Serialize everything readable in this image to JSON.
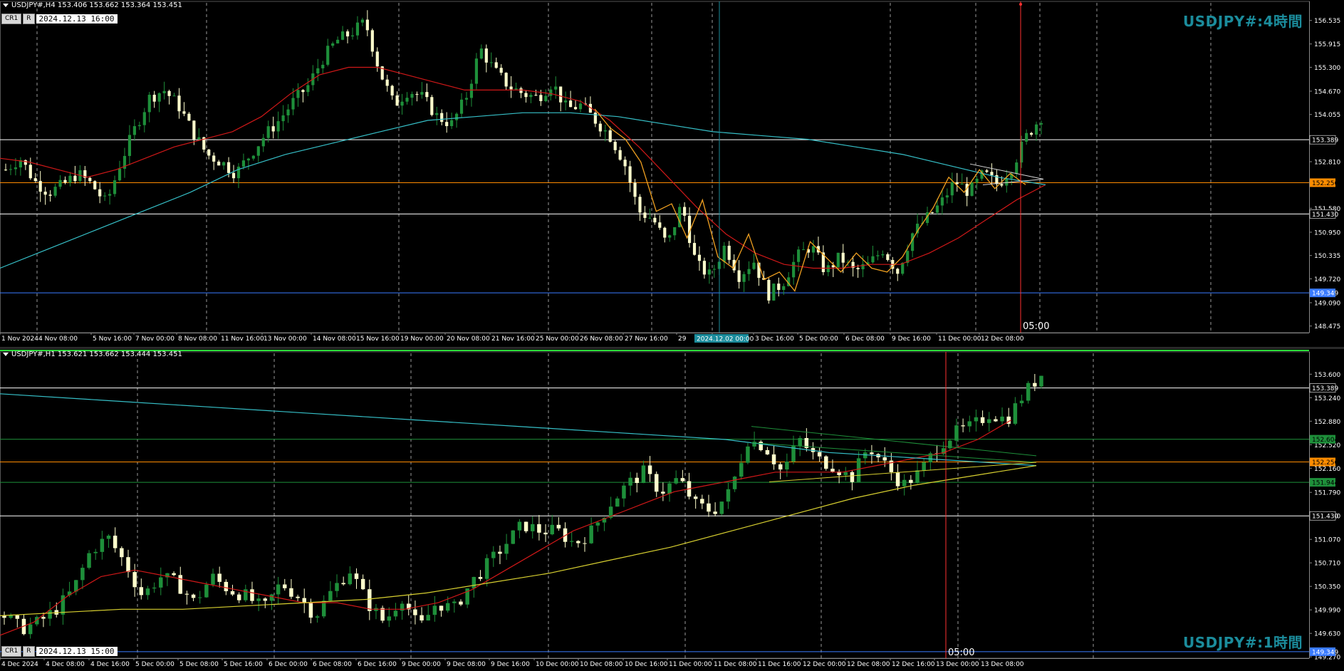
{
  "top": {
    "info": "USDJPY#,H4  153.406 153.662 153.364 153.451",
    "btn_cr": "CR1",
    "btn_r": "R",
    "date": "2024.12.13 16:00",
    "big_title": "USDJPY#:4時間",
    "countdown": "05:00",
    "crosshair_label": "2024.12.02 00:00"
  },
  "bottom": {
    "info": "USDJPY#,H1  153.621 153.662 153.444 153.451",
    "btn_cr": "CR1",
    "btn_r": "R",
    "date": "2024.12.13 15:00",
    "big_title": "USDJPY#:1時間",
    "countdown": "05:00"
  },
  "colors": {
    "bull": "#1e8f3a",
    "bear": "#ffffcc",
    "ma_red": "#d01818",
    "ma_cyan": "#36c0c8",
    "ma_yellow": "#d8d030",
    "zigzag": "#f0a020",
    "level_white": "#ffffff",
    "level_orange": "#ff8c00",
    "level_blue": "#3a7bff",
    "level_green": "#1e8f3a",
    "vline_cyan": "#1b8c9c",
    "vline_red": "#ff3030",
    "grid": "#9a9a9a"
  },
  "chart_data": [
    {
      "type": "candlestick",
      "timeframe": "H4",
      "symbol": "USDJPY#",
      "ylim": [
        148.3,
        157.0
      ],
      "yticks": [
        "156.535",
        "155.915",
        "155.300",
        "154.670",
        "154.055",
        "152.810",
        "151.580",
        "150.950",
        "150.335",
        "149.720",
        "149.090",
        "148.475"
      ],
      "levels": [
        {
          "name": "resistance-1",
          "value": 153.389,
          "color": "#ffffff",
          "label": "153.389",
          "label_bg": "#000000",
          "label_fg": "#ffffff"
        },
        {
          "name": "pivot",
          "value": 152.256,
          "color": "#ff8c00",
          "label": "152.256",
          "label_bg": "#ff8c00",
          "label_fg": "#000000"
        },
        {
          "name": "support-1",
          "value": 151.43,
          "color": "#ffffff",
          "label": "151.430",
          "label_bg": "#000000",
          "label_fg": "#ffffff"
        },
        {
          "name": "support-2",
          "value": 149.349,
          "color": "#3a7bff",
          "label": "149.349",
          "label_bg": "#3a7bff",
          "label_fg": "#ffffff"
        }
      ],
      "xticks": [
        "1 Nov 2024",
        "4 Nov 08:00",
        "5 Nov 16:00",
        "7 Nov 00:00",
        "8 Nov 08:00",
        "11 Nov 16:00",
        "13 Nov 00:00",
        "14 Nov 08:00",
        "15 Nov 16:00",
        "19 Nov 00:00",
        "20 Nov 08:00",
        "21 Nov 16:00",
        "25 Nov 00:00",
        "26 Nov 08:00",
        "27 Nov 16:00",
        "29 ",
        "08:00",
        "3 Dec 16:00",
        "5 Dec 00:00",
        "6 Dec 08:00",
        "9 Dec 16:00",
        "11 Dec 00:00",
        "12 Dec 08:00"
      ],
      "anchors": [
        152.6,
        152.9,
        152.3,
        152.0,
        152.2,
        152.5,
        152.2,
        151.7,
        152.8,
        153.7,
        154.5,
        154.7,
        154.3,
        153.6,
        153.0,
        152.8,
        152.5,
        153.0,
        153.5,
        153.9,
        154.4,
        154.8,
        155.5,
        156.0,
        156.2,
        156.5,
        155.2,
        154.3,
        154.7,
        154.5,
        154.0,
        153.8,
        154.5,
        155.8,
        155.2,
        154.8,
        154.6,
        154.5,
        154.9,
        154.2,
        154.3,
        153.9,
        153.5,
        152.8,
        151.5,
        151.3,
        150.6,
        151.7,
        150.1,
        149.8,
        150.6,
        149.8,
        150.2,
        149.3,
        149.6,
        150.3,
        150.6,
        149.9,
        150.3,
        149.9,
        150.1,
        150.5,
        149.9,
        150.9,
        151.3,
        151.7,
        152.3,
        152.0,
        152.5,
        152.2,
        152.7,
        153.5,
        154.0
      ],
      "ma_red": [
        152.9,
        152.8,
        152.6,
        152.4,
        152.6,
        152.9,
        153.2,
        153.4,
        153.6,
        154.0,
        154.6,
        155.1,
        155.3,
        155.3,
        155.1,
        154.9,
        154.7,
        154.7,
        154.7,
        154.6,
        154.4,
        153.9,
        153.2,
        152.4,
        151.6,
        150.9,
        150.4,
        150.1,
        150.0,
        150.0,
        150.1,
        150.1,
        150.4,
        150.8,
        151.3,
        151.8,
        152.2
      ],
      "ma_cyan": [
        150.0,
        150.5,
        151.0,
        151.5,
        152.0,
        152.6,
        153.0,
        153.3,
        153.6,
        153.9,
        154.0,
        154.1,
        154.1,
        154.0,
        153.8,
        153.6,
        153.5,
        153.4,
        153.2,
        153.0,
        152.7,
        152.4,
        152.2
      ],
      "zigzag": [
        154.2,
        153.7,
        153.4,
        152.8,
        151.5,
        151.7,
        150.8,
        151.8,
        150.3,
        150.0,
        150.9,
        149.7,
        149.9,
        149.4,
        150.7,
        150.3,
        149.9,
        150.4,
        150.0,
        149.9,
        150.3,
        151.0,
        151.6,
        152.4,
        152.0,
        152.6,
        152.1,
        152.5,
        152.2
      ]
    },
    {
      "type": "candlestick",
      "timeframe": "H1",
      "symbol": "USDJPY#",
      "ylim": [
        149.25,
        153.92
      ],
      "yticks": [
        "153.600",
        "153.240",
        "152.880",
        "152.520",
        "152.160",
        "151.790",
        "151.430",
        "151.070",
        "150.710",
        "150.350",
        "149.990",
        "149.630",
        "149.270"
      ],
      "levels": [
        {
          "name": "resistance-1",
          "value": 153.389,
          "color": "#ffffff",
          "label": "153.389",
          "label_bg": "#000000",
          "label_fg": "#ffffff"
        },
        {
          "name": "green-upper",
          "value": 152.604,
          "color": "#1e8f3a",
          "label": "152.604",
          "label_bg": "#1e8f3a",
          "label_fg": "#000000"
        },
        {
          "name": "pivot",
          "value": 152.256,
          "color": "#ff8c00",
          "label": "152.256",
          "label_bg": "#ff8c00",
          "label_fg": "#000000"
        },
        {
          "name": "green-lower",
          "value": 151.944,
          "color": "#1e8f3a",
          "label": "151.944",
          "label_bg": "#1e8f3a",
          "label_fg": "#000000"
        },
        {
          "name": "support-1",
          "value": 151.43,
          "color": "#ffffff",
          "label": "151.430",
          "label_bg": "#000000",
          "label_fg": "#ffffff"
        },
        {
          "name": "support-2",
          "value": 149.349,
          "color": "#3a7bff",
          "label": "149.349",
          "label_bg": "#3a7bff",
          "label_fg": "#ffffff"
        }
      ],
      "xticks": [
        "4 Dec 2024",
        "4 Dec 08:00",
        "4 Dec 16:00",
        "5 Dec 00:00",
        "5 Dec 08:00",
        "5 Dec 16:00",
        "6 Dec 00:00",
        "6 Dec 08:00",
        "6 Dec 16:00",
        "9 Dec 00:00",
        "9 Dec 08:00",
        "9 Dec 16:00",
        "10 Dec 00:00",
        "10 Dec 08:00",
        "10 Dec 16:00",
        "11 Dec 00:00",
        "11 Dec 08:00",
        "11 Dec 16:00",
        "12 Dec 00:00",
        "12 Dec 08:00",
        "12 Dec 16:00",
        "13 Dec 00:00",
        "13 Dec 08:00"
      ],
      "anchors": [
        149.9,
        149.7,
        149.8,
        150.0,
        150.3,
        150.9,
        151.1,
        150.7,
        150.2,
        150.5,
        150.4,
        150.1,
        150.5,
        150.3,
        150.2,
        150.0,
        150.4,
        150.2,
        149.9,
        150.3,
        150.6,
        150.1,
        149.8,
        150.2,
        149.7,
        150.1,
        150.0,
        150.4,
        150.7,
        151.0,
        151.3,
        151.2,
        151.2,
        151.0,
        151.2,
        151.6,
        151.9,
        152.1,
        151.8,
        152.0,
        151.6,
        151.5,
        151.8,
        152.6,
        152.5,
        152.1,
        152.6,
        152.3,
        152.2,
        152.0,
        152.5,
        152.2,
        151.9,
        152.1,
        152.5,
        152.7,
        152.8,
        153.0,
        152.9,
        153.3,
        153.6
      ],
      "ma_red": [
        149.6,
        149.8,
        150.2,
        150.5,
        150.6,
        150.5,
        150.4,
        150.3,
        150.2,
        150.1,
        150.1,
        150.0,
        150.0,
        150.1,
        150.3,
        150.6,
        150.9,
        151.2,
        151.4,
        151.6,
        151.8,
        151.9,
        152.0,
        152.1,
        152.1,
        152.1,
        152.2,
        152.3,
        152.4,
        152.6,
        152.9
      ],
      "ma_cyan": [
        153.3,
        153.2,
        153.1,
        153.0,
        152.9,
        152.8,
        152.7,
        152.6,
        152.4,
        152.3,
        152.2
      ],
      "ma_yellow": [
        149.9,
        149.95,
        150.0,
        150.0,
        150.05,
        150.1,
        150.15,
        150.25,
        150.4,
        150.55,
        150.75,
        150.95,
        151.2,
        151.45,
        151.7,
        151.9,
        152.05,
        152.2
      ]
    }
  ]
}
